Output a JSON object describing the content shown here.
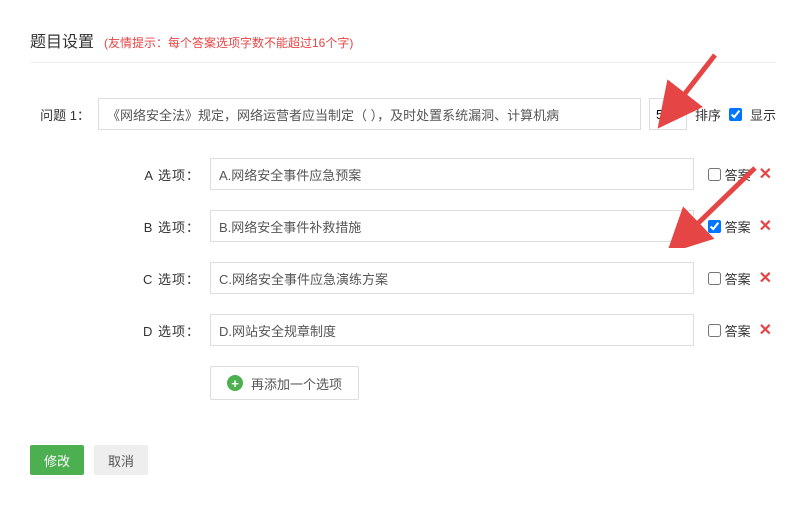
{
  "header": {
    "title": "题目设置",
    "hint": "(友情提示：每个答案选项字数不能超过16个字)"
  },
  "question": {
    "label": "问题 1：",
    "text": "《网络安全法》规定，网络运营者应当制定（ ），及时处置系统漏洞、计算机病",
    "sort_value": "50",
    "sort_label": "排序",
    "display_label": "显示",
    "display_checked": true
  },
  "options": [
    {
      "letter": "A",
      "label": "A 选项：",
      "text": "A.网络安全事件应急预案",
      "is_answer": false
    },
    {
      "letter": "B",
      "label": "B 选项：",
      "text": "B.网络安全事件补救措施",
      "is_answer": true
    },
    {
      "letter": "C",
      "label": "C 选项：",
      "text": "C.网络安全事件应急演练方案",
      "is_answer": false
    },
    {
      "letter": "D",
      "label": "D 选项：",
      "text": "D.网站安全规章制度",
      "is_answer": false
    }
  ],
  "labels": {
    "answer": "答案",
    "delete": "✕",
    "add_option": "再添加一个选项",
    "submit": "修改",
    "cancel": "取消"
  }
}
